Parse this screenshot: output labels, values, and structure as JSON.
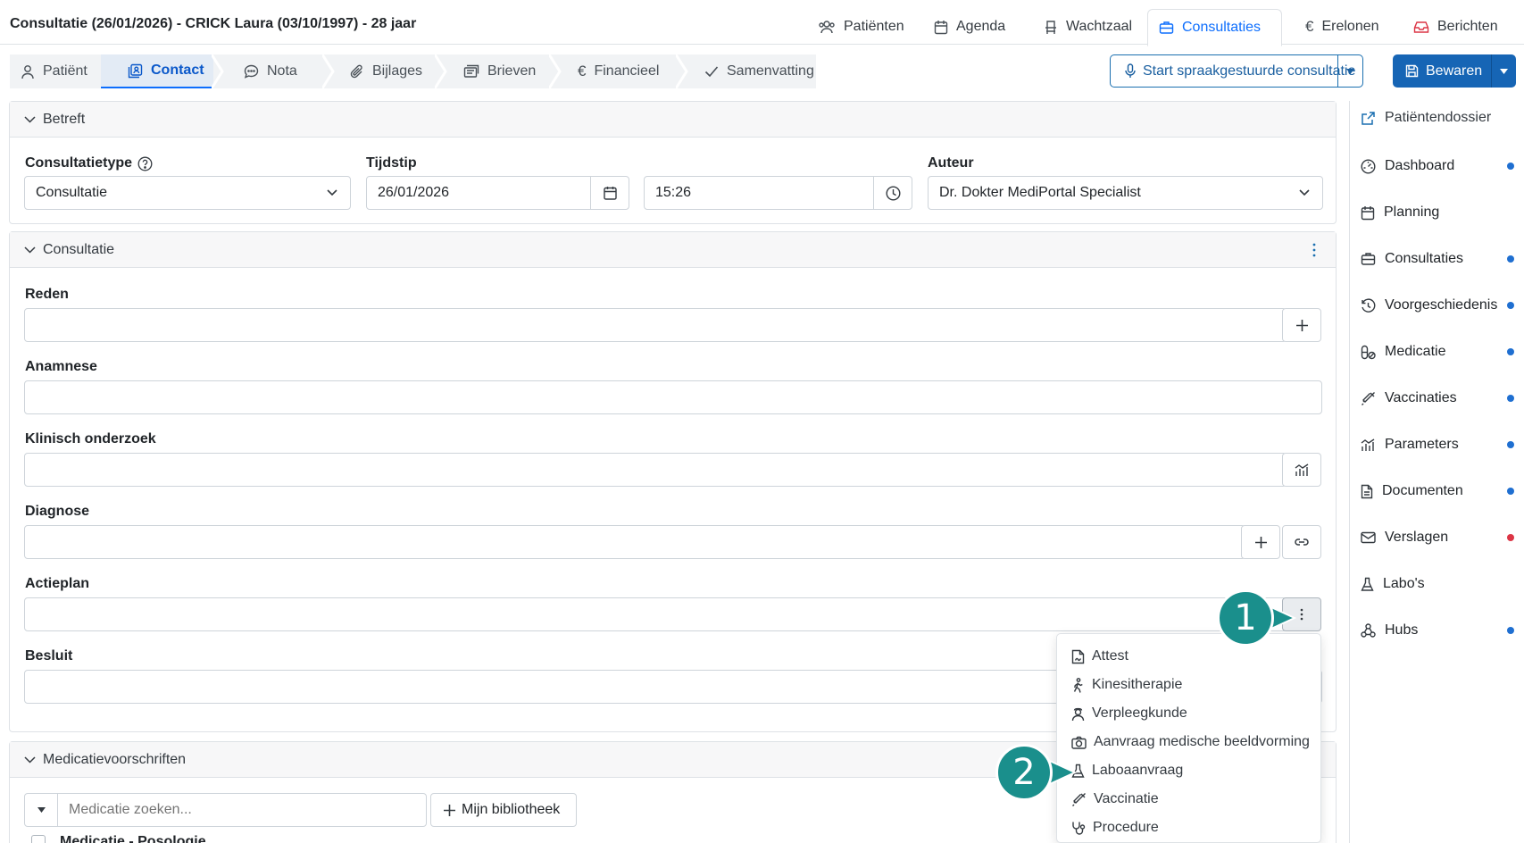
{
  "header": {
    "title": "Consultatie (26/01/2026) - CRICK Laura (03/10/1997) - 28 jaar",
    "nav": [
      {
        "label": "Patiënten",
        "icon": "users-icon"
      },
      {
        "label": "Agenda",
        "icon": "calendar-icon"
      },
      {
        "label": "Wachtzaal",
        "icon": "chair-icon"
      },
      {
        "label": "Consultaties",
        "icon": "briefcase-icon",
        "active": true
      },
      {
        "label": "Erelonen",
        "icon": "euro-icon"
      },
      {
        "label": "Berichten",
        "icon": "inbox-icon"
      }
    ]
  },
  "subtabs": [
    {
      "label": "Patiënt",
      "icon": "person-icon"
    },
    {
      "label": "Contact",
      "icon": "contact-icon",
      "active": true
    },
    {
      "label": "Nota",
      "icon": "chat-icon"
    },
    {
      "label": "Bijlages",
      "icon": "paperclip-icon"
    },
    {
      "label": "Brieven",
      "icon": "letters-icon"
    },
    {
      "label": "Financieel",
      "icon": "euro-icon"
    },
    {
      "label": "Samenvatting",
      "icon": "check-icon"
    }
  ],
  "actions": {
    "voice_label": "Start spraakgestuurde consultatie",
    "save_label": "Bewaren"
  },
  "betreft": {
    "title": "Betreft",
    "type_label": "Consultatietype",
    "type_value": "Consultatie",
    "time_label": "Tijdstip",
    "date_value": "26/01/2026",
    "time_value": "15:26",
    "author_label": "Auteur",
    "author_value": "Dr. Dokter MediPortal Specialist"
  },
  "consultatie": {
    "title": "Consultatie",
    "fields": {
      "reden": "Reden",
      "anamnese": "Anamnese",
      "klinisch": "Klinisch onderzoek",
      "diagnose": "Diagnose",
      "actieplan": "Actieplan",
      "besluit": "Besluit"
    }
  },
  "medicatie": {
    "title": "Medicatievoorschriften",
    "search_placeholder": "Medicatie zoeken...",
    "library_label": "Mijn bibliotheek",
    "table_head": "Medicatie - Posologie"
  },
  "sidebar": [
    {
      "label": "Patiëntendossier",
      "icon": "external-link-icon",
      "dot": ""
    },
    {
      "label": "Dashboard",
      "icon": "gauge-icon",
      "dot": "#1f6fd1"
    },
    {
      "label": "Planning",
      "icon": "calendar-icon",
      "dot": ""
    },
    {
      "label": "Consultaties",
      "icon": "briefcase-icon",
      "dot": "#1f6fd1"
    },
    {
      "label": "Voorgeschiedenis",
      "icon": "history-icon",
      "dot": "#1f6fd1"
    },
    {
      "label": "Medicatie",
      "icon": "pill-icon",
      "dot": "#1f6fd1"
    },
    {
      "label": "Vaccinaties",
      "icon": "syringe-icon",
      "dot": "#1f6fd1"
    },
    {
      "label": "Parameters",
      "icon": "chart-icon",
      "dot": "#1f6fd1"
    },
    {
      "label": "Documenten",
      "icon": "document-icon",
      "dot": "#1f6fd1"
    },
    {
      "label": "Verslagen",
      "icon": "envelope-icon",
      "dot": "#dc3545"
    },
    {
      "label": "Labo's",
      "icon": "flask-icon",
      "dot": ""
    },
    {
      "label": "Hubs",
      "icon": "hubs-icon",
      "dot": "#1f6fd1"
    }
  ],
  "dropdown": [
    {
      "label": "Attest",
      "icon": "attest-icon"
    },
    {
      "label": "Kinesitherapie",
      "icon": "walking-icon"
    },
    {
      "label": "Verpleegkunde",
      "icon": "nurse-icon"
    },
    {
      "label": "Aanvraag medische beeldvorming",
      "icon": "camera-icon"
    },
    {
      "label": "Laboaanvraag",
      "icon": "flask-icon"
    },
    {
      "label": "Vaccinatie",
      "icon": "syringe-icon"
    },
    {
      "label": "Procedure",
      "icon": "stethoscope-icon"
    }
  ],
  "callouts": [
    "1",
    "2"
  ],
  "colors": {
    "primary": "#1665b5",
    "accent_teal": "#1a8f8c",
    "dot_blue": "#1f6fd1",
    "dot_red": "#dc3545"
  }
}
